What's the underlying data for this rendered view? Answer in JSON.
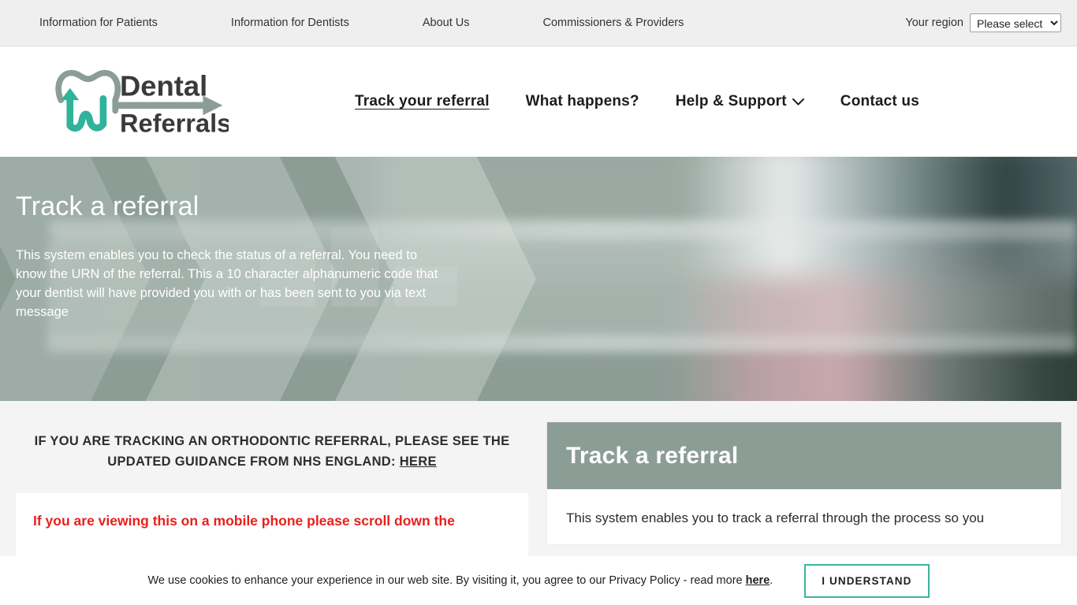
{
  "colors": {
    "accent_teal": "#3cb59a",
    "hero_green": "#8c9d96",
    "topbar_gray": "#efefef",
    "page_gray": "#f4f4f4",
    "alert_red": "#e8201c"
  },
  "topbar": {
    "links": [
      {
        "label": "Information for Patients"
      },
      {
        "label": "Information for Dentists"
      },
      {
        "label": "About Us"
      },
      {
        "label": "Commissioners & Providers"
      }
    ],
    "region_label": "Your region",
    "region_selected": "Please select",
    "region_options": [
      "Please select"
    ]
  },
  "header": {
    "logo_line1": "Dental",
    "logo_line2": "Referrals",
    "logo_alt": "dental-referrals-logo",
    "nav": [
      {
        "label": "Track your referral",
        "active": true,
        "has_chevron": false
      },
      {
        "label": "What happens?",
        "active": false,
        "has_chevron": false
      },
      {
        "label": "Help & Support",
        "active": false,
        "has_chevron": true
      },
      {
        "label": "Contact us",
        "active": false,
        "has_chevron": false
      }
    ]
  },
  "hero": {
    "title": "Track a referral",
    "body": "This system enables you to check the status of a referral. You need to know the URN of the referral. This a 10 character alphanumeric code that your dentist will have provided you with or has been sent to you via text message"
  },
  "content": {
    "notice_before_link": "IF YOU ARE TRACKING AN ORTHODONTIC REFERRAL, PLEASE SEE THE UPDATED GUIDANCE FROM NHS ENGLAND: ",
    "notice_link": "HERE",
    "mobile_warning": "If you are viewing this on a mobile phone please scroll down the",
    "card_title": "Track a referral",
    "card_text": "This system enables you to track a referral through the process so you"
  },
  "cookie": {
    "text_before_link": "We use cookies to enhance your experience in our web site. By visiting it, you agree to our Privacy Policy - read more ",
    "link": "here",
    "text_after_link": ".",
    "button_label": "I UNDERSTAND"
  }
}
